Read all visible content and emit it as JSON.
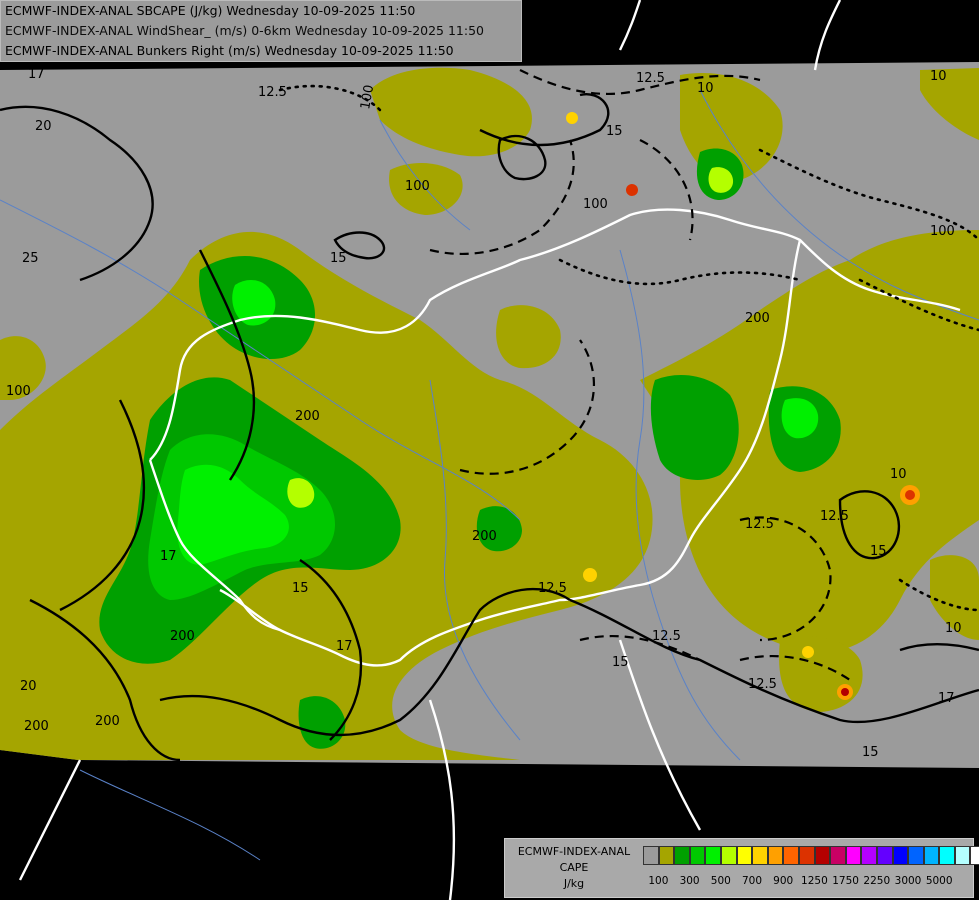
{
  "header": {
    "line1": "ECMWF-INDEX-ANAL SBCAPE (J/kg) Wednesday 10-09-2025 11:50",
    "line2": "ECMWF-INDEX-ANAL WindShear_ (m/s) 0-6km Wednesday 10-09-2025 11:50",
    "line3": "ECMWF-INDEX-ANAL Bunkers Right (m/s) Wednesday 10-09-2025 11:50"
  },
  "legend": {
    "title1": "ECMWF-INDEX-ANAL",
    "title2": "CAPE",
    "unit": "J/kg",
    "colors": [
      "#9b9b9b",
      "#a5a500",
      "#00a000",
      "#00c800",
      "#00f000",
      "#b4ff00",
      "#ffff00",
      "#ffd200",
      "#ffa000",
      "#ff6400",
      "#dc3200",
      "#b40000",
      "#c80064",
      "#ff00ff",
      "#b400ff",
      "#6400ff",
      "#0000ff",
      "#0064ff",
      "#00b4ff",
      "#00ffff",
      "#b4ffff",
      "#ffffff"
    ],
    "tick_labels": [
      "100",
      "300",
      "500",
      "700",
      "900",
      "1250",
      "1750",
      "2250",
      "3000",
      "5000"
    ]
  },
  "map": {
    "colors": {
      "background": "#000000",
      "domain_gray": "#9b9b9b",
      "olive": "#a5a500",
      "green_dark": "#00a000",
      "green": "#00c800",
      "green_bright": "#00f000",
      "yellow_green": "#b4ff00",
      "border_white": "#ffffff",
      "river_blue": "#5a82c8",
      "contour": "#000000"
    },
    "contour_labels": [
      "12.5",
      "10",
      "15",
      "100",
      "20",
      "25",
      "100",
      "17",
      "200",
      "12.5",
      "15",
      "100",
      "200",
      "10",
      "15",
      "12.5",
      "100",
      "200",
      "200",
      "17",
      "20",
      "200",
      "12.5",
      "12.5",
      "15",
      "17",
      "10",
      "200",
      "100",
      "15",
      "12.5",
      "10",
      "15",
      "12.5",
      "17"
    ]
  }
}
